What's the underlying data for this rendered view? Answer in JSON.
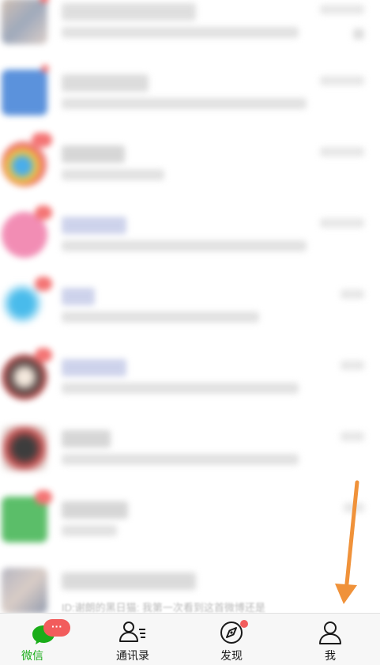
{
  "chat_list": {
    "last_preview": "ID:谢朗的黑日猫: 我第一次看到这首微博还是"
  },
  "tabbar": {
    "tabs": [
      {
        "label": "微信",
        "icon": "chat-bubble-icon",
        "active": true,
        "badge": "···"
      },
      {
        "label": "通讯录",
        "icon": "contacts-icon",
        "active": false
      },
      {
        "label": "发现",
        "icon": "compass-icon",
        "active": false,
        "dot": true
      },
      {
        "label": "我",
        "icon": "person-icon",
        "active": false
      }
    ]
  },
  "colors": {
    "accent": "#1aad19",
    "badge": "#f25c5c",
    "arrow": "#f0923a"
  }
}
